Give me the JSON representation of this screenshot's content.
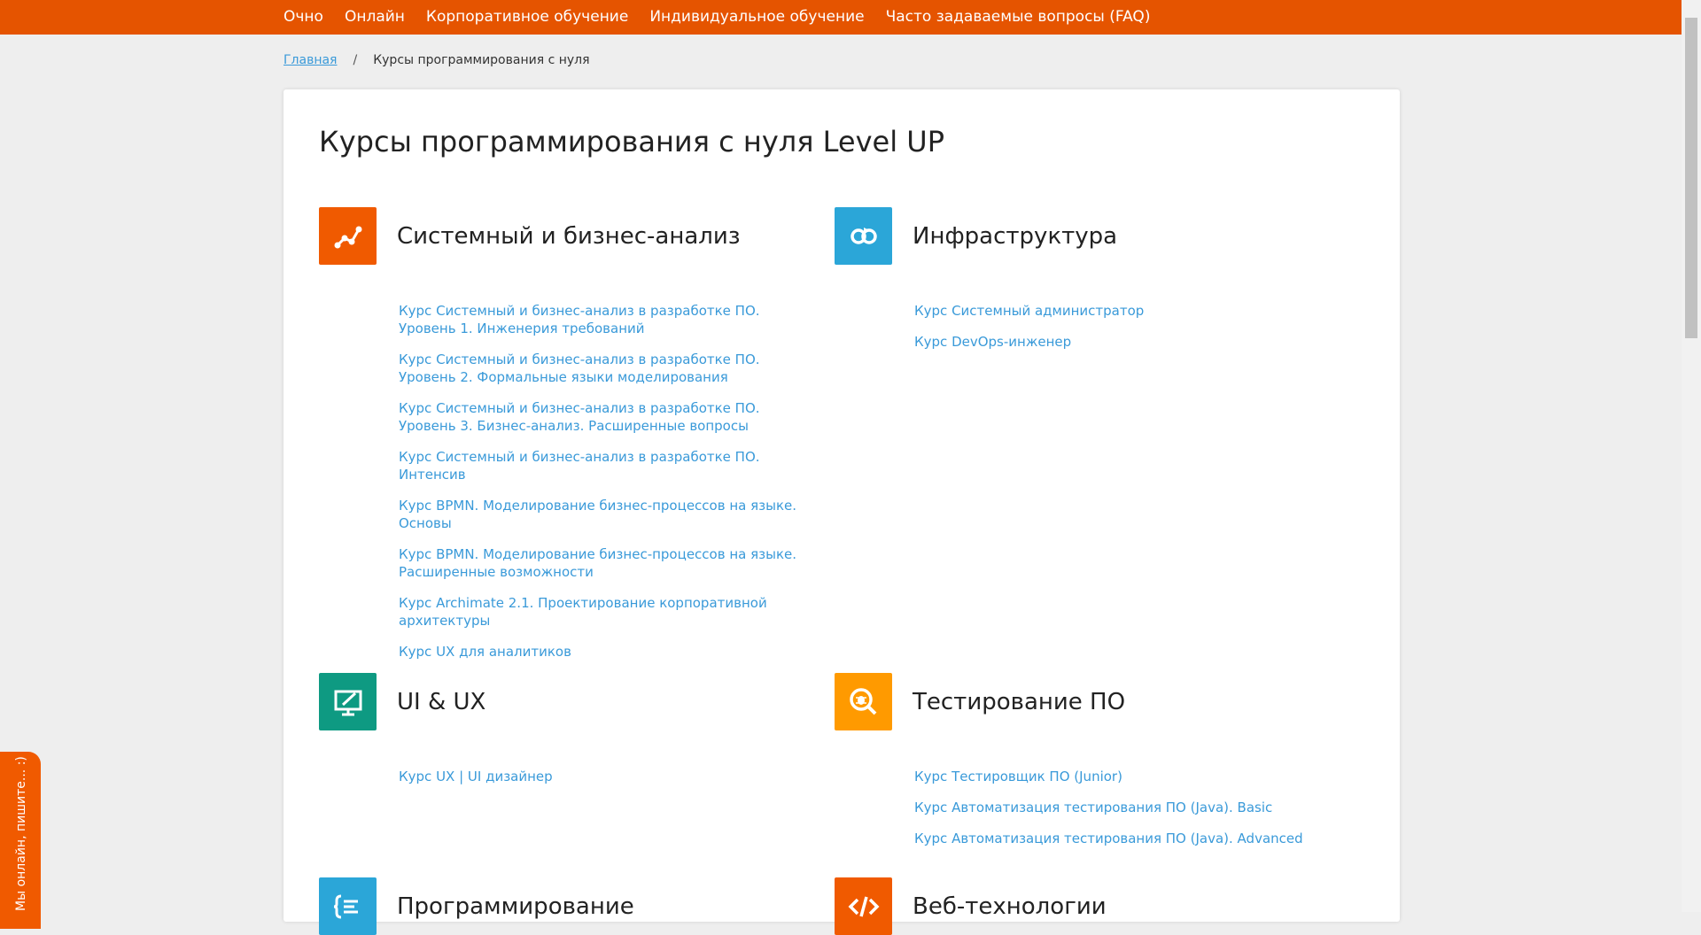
{
  "nav": {
    "items": [
      "Очно",
      "Онлайн",
      "Корпоративное обучение",
      "Индивидуальное обучение",
      "Часто задаваемые вопросы (FAQ)"
    ]
  },
  "breadcrumb": {
    "home": "Главная",
    "separator": "/",
    "current": "Курсы программирования с нуля"
  },
  "page": {
    "title": "Курсы программирования с нуля Level UP"
  },
  "categories": [
    {
      "title": "Системный и бизнес-анализ",
      "icon": "analytics-chart-icon",
      "color": "#f05a00",
      "courses": [
        "Курс Системный и бизнес-анализ в разработке ПО. Уровень 1. Инженерия требований",
        "Курс Системный и бизнес-анализ в разработке ПО. Уровень 2. Формальные языки моделирования",
        "Курс Системный и бизнес-анализ в разработке ПО. Уровень 3. Бизнес-анализ. Расширенные вопросы",
        "Курс Системный и бизнес-анализ в разработке ПО. Интенсив",
        "Курс BPMN. Моделирование бизнес-процессов на языке. Основы",
        "Курс BPMN. Моделирование бизнес-процессов на языке. Расширенные возможности",
        "Курс Archimate 2.1. Проектирование корпоративной архитектуры",
        "Курс UX для аналитиков"
      ]
    },
    {
      "title": "Инфраструктура",
      "icon": "infrastructure-loop-icon",
      "color": "#2ba6d8",
      "courses": [
        "Курс Системный администратор",
        "Курс DevOps-инженер"
      ]
    },
    {
      "title": "UI & UX",
      "icon": "monitor-pen-icon",
      "color": "#0e9a82",
      "courses": [
        "Курс UX | UI дизайнер"
      ]
    },
    {
      "title": "Тестирование ПО",
      "icon": "bug-search-icon",
      "color": "#ff9a00",
      "courses": [
        "Курс Тестировщик ПО (Junior)",
        "Курс Автоматизация тестирования ПО (Java). Basic",
        "Курс Автоматизация тестирования ПО (Java). Advanced"
      ]
    },
    {
      "title": "Программирование",
      "icon": "code-braces-icon",
      "color": "#2ba6d8",
      "courses": []
    },
    {
      "title": "Веб-технологии",
      "icon": "code-tag-icon",
      "color": "#f05a00",
      "courses": []
    }
  ],
  "chat": {
    "label": "Мы онлайн, пишите... :)"
  }
}
